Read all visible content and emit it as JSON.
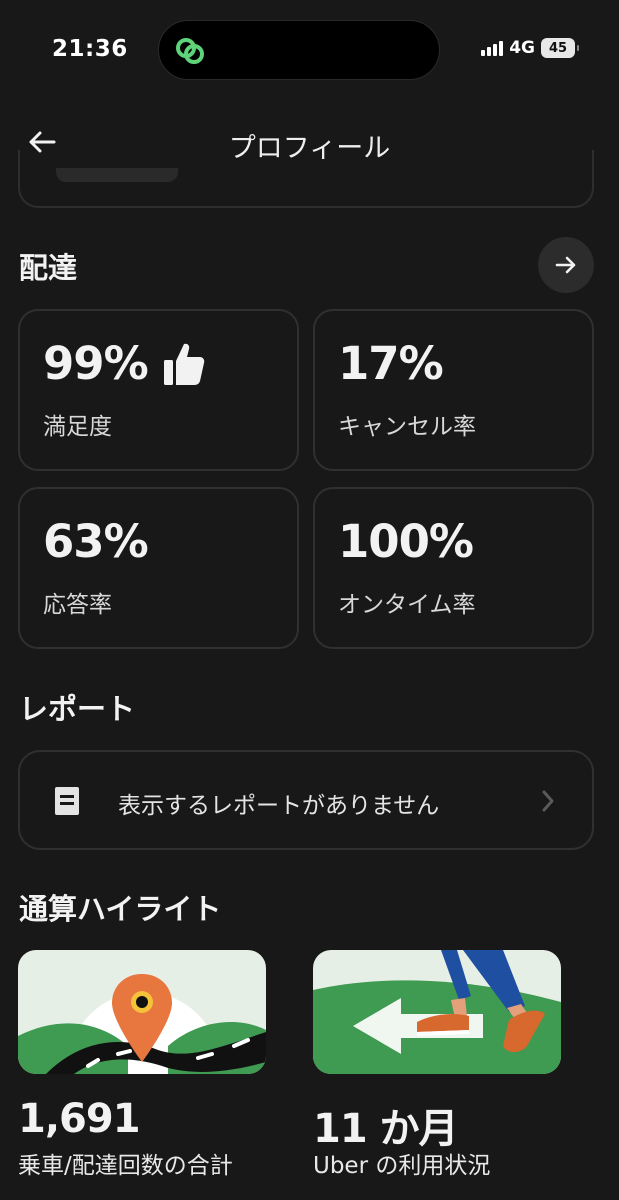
{
  "status_bar": {
    "time": "21:36",
    "network": "4G",
    "battery": "45"
  },
  "nav": {
    "title": "プロフィール"
  },
  "delivery": {
    "title": "配達",
    "stats": [
      {
        "value": "99%",
        "label": "満足度",
        "icon": "thumbs-up-icon"
      },
      {
        "value": "17%",
        "label": "キャンセル率"
      },
      {
        "value": "63%",
        "label": "応答率"
      },
      {
        "value": "100%",
        "label": "オンタイム率"
      }
    ]
  },
  "reports": {
    "title": "レポート",
    "empty_text": "表示するレポートがありません"
  },
  "highlights": {
    "title": "通算ハイライト",
    "items": [
      {
        "value": "1,691",
        "label": "乗車/配達回数の合計",
        "illustration": "map-pin-road-illustration"
      },
      {
        "value": "11 か月",
        "label": "Uber の利用状況",
        "illustration": "walking-arrow-illustration"
      }
    ]
  },
  "colors": {
    "background": "#181818",
    "card_border": "#303030",
    "green": "#3f9a52",
    "pin_orange": "#e8763f",
    "accent_green": "#5ed37a"
  }
}
